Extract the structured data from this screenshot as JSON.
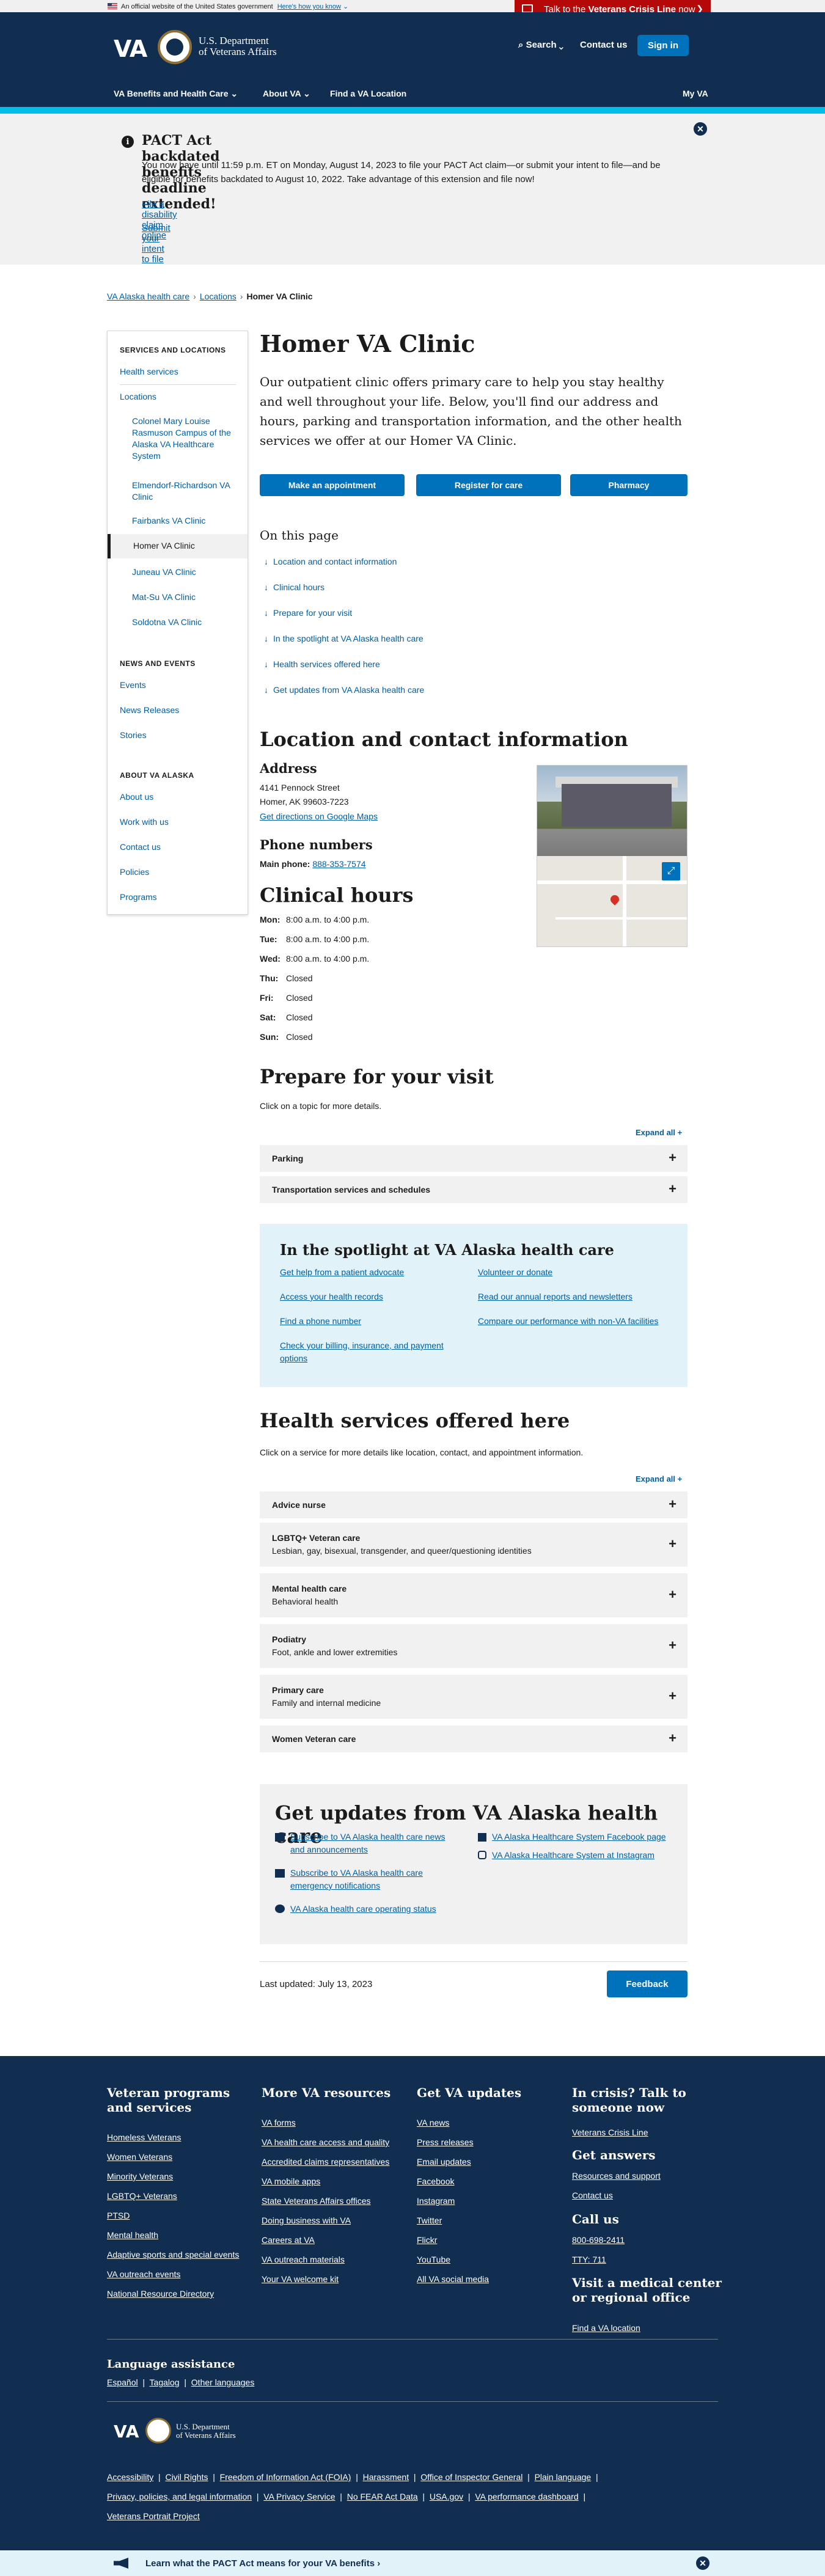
{
  "gov_banner": {
    "text": "An official website of the United States government",
    "how_link": "Here's how you know"
  },
  "crisis": {
    "prefix": "Talk to the ",
    "bold": "Veterans Crisis Line",
    "suffix": " now"
  },
  "header": {
    "logo": "VA",
    "dept_line1": "U.S. Department",
    "dept_line2": "of Veterans Affairs",
    "search": "Search",
    "contact": "Contact us",
    "signin": "Sign in",
    "nav": [
      "VA Benefits and Health Care",
      "About VA",
      "Find a VA Location",
      "My VA"
    ]
  },
  "alert": {
    "title": "PACT Act backdated benefits deadline extended!",
    "body": "You now have until 11:59 p.m. ET on Monday, August 14, 2023 to file your PACT Act claim—or submit your intent to file—and be eligible for benefits backdated to August 10, 2022. Take advantage of this extension and file now!",
    "link1": "File a disability claim online",
    "link2": "Submit your intent to file"
  },
  "breadcrumb": [
    "VA Alaska health care",
    "Locations",
    "Homer VA Clinic"
  ],
  "sidebar": {
    "h1": "SERVICES AND LOCATIONS",
    "health_services": "Health services",
    "locations": "Locations",
    "loc_items": [
      "Colonel Mary Louise Rasmuson Campus of the Alaska VA Healthcare System",
      "Elmendorf-Richardson VA Clinic",
      "Fairbanks VA Clinic",
      "Homer VA Clinic",
      "Juneau VA Clinic",
      "Mat-Su VA Clinic",
      "Soldotna VA Clinic"
    ],
    "h2": "NEWS AND EVENTS",
    "news": [
      "Events",
      "News Releases",
      "Stories"
    ],
    "h3": "ABOUT VA ALASKA",
    "about": [
      "About us",
      "Work with us",
      "Contact us",
      "Policies",
      "Programs"
    ]
  },
  "main": {
    "title": "Homer VA Clinic",
    "intro": "Our outpatient clinic offers primary care to help you stay healthy and well throughout your life. Below, you'll find our address and hours, parking and transportation information, and the other health services we offer at our Homer VA Clinic.",
    "buttons": [
      "Make an appointment",
      "Register for care",
      "Pharmacy"
    ],
    "on_this_page": "On this page",
    "jump_links": [
      "Location and contact information",
      "Clinical hours",
      "Prepare for your visit",
      "In the spotlight at VA Alaska health care",
      "Health services offered here",
      "Get updates from VA Alaska health care"
    ],
    "location_heading": "Location and contact information",
    "address_heading": "Address",
    "address_line1": "4141 Pennock Street",
    "address_line2": "Homer, AK 99603-7223",
    "directions": "Get directions on Google Maps",
    "phone_heading": "Phone numbers",
    "main_phone_label": "Main phone:",
    "main_phone": "888-353-7574",
    "hours_heading": "Clinical hours",
    "hours": [
      {
        "day": "Mon:",
        "time": "8:00 a.m. to 4:00 p.m."
      },
      {
        "day": "Tue:",
        "time": "8:00 a.m. to 4:00 p.m."
      },
      {
        "day": "Wed:",
        "time": "8:00 a.m. to 4:00 p.m."
      },
      {
        "day": "Thu:",
        "time": "Closed"
      },
      {
        "day": "Fri:",
        "time": "Closed"
      },
      {
        "day": "Sat:",
        "time": "Closed"
      },
      {
        "day": "Sun:",
        "time": "Closed"
      }
    ],
    "prepare_heading": "Prepare for your visit",
    "prepare_sub": "Click on a topic for more details.",
    "expand_all": "Expand all +",
    "prepare_items": [
      "Parking",
      "Transportation services and schedules"
    ],
    "spotlight_heading": "In the spotlight at VA Alaska health care",
    "spotlight_left": [
      "Get help from a patient advocate",
      "Access your health records",
      "Find a phone number",
      "Check your billing, insurance, and payment options"
    ],
    "spotlight_right": [
      "Volunteer or donate",
      "Read our annual reports and newsletters",
      "Compare our performance with non-VA facilities"
    ],
    "services_heading": "Health services offered here",
    "services_sub": "Click on a service for more details like location, contact, and appointment information.",
    "services": [
      {
        "title": "Advice nurse",
        "sub": ""
      },
      {
        "title": "LGBTQ+ Veteran care",
        "sub": "Lesbian, gay, bisexual, transgender, and queer/questioning identities"
      },
      {
        "title": "Mental health care",
        "sub": "Behavioral health"
      },
      {
        "title": "Podiatry",
        "sub": "Foot, ankle and lower extremities"
      },
      {
        "title": "Primary care",
        "sub": "Family and internal medicine"
      },
      {
        "title": "Women Veteran care",
        "sub": ""
      }
    ],
    "updates_heading": "Get updates from VA Alaska health care",
    "updates_left": [
      "Subscribe to VA Alaska health care news and announcements",
      "Subscribe to VA Alaska health care emergency notifications",
      "VA Alaska health care operating status"
    ],
    "updates_right": [
      "VA Alaska Healthcare System Facebook page",
      "VA Alaska Healthcare System at Instagram"
    ],
    "last_updated": "Last updated: July 13, 2023",
    "feedback": "Feedback"
  },
  "footer": {
    "col1_heading": "Veteran programs and services",
    "col1": [
      "Homeless Veterans",
      "Women Veterans",
      "Minority Veterans",
      "LGBTQ+ Veterans",
      "PTSD",
      "Mental health",
      "Adaptive sports and special events",
      "VA outreach events",
      "National Resource Directory"
    ],
    "col2_heading": "More VA resources",
    "col2": [
      "VA forms",
      "VA health care access and quality",
      "Accredited claims representatives",
      "VA mobile apps",
      "State Veterans Affairs offices",
      "Doing business with VA",
      "Careers at VA",
      "VA outreach materials",
      "Your VA welcome kit"
    ],
    "col3_heading": "Get VA updates",
    "col3": [
      "VA news",
      "Press releases",
      "Email updates",
      "Facebook",
      "Instagram",
      "Twitter",
      "Flickr",
      "YouTube",
      "All VA social media"
    ],
    "col4_heading": "In crisis? Talk to someone now",
    "col4_link": "Veterans Crisis Line",
    "answers_heading": "Get answers",
    "answers": [
      "Resources and support",
      "Contact us"
    ],
    "call_heading": "Call us",
    "call": [
      "800-698-2411",
      "TTY: 711"
    ],
    "visit_heading": "Visit a medical center or regional office",
    "visit_link": "Find a VA location",
    "lang_heading": "Language assistance",
    "langs": [
      "Español",
      "Tagalog",
      "Other languages"
    ],
    "bottom_links_row1": [
      "Accessibility",
      "Civil Rights",
      "Freedom of Information Act (FOIA)",
      "Harassment",
      "Office of Inspector General",
      "Plain language"
    ],
    "bottom_links_row2": [
      "Privacy, policies, and legal information",
      "VA Privacy Service",
      "No FEAR Act Data",
      "USA.gov",
      "VA performance dashboard"
    ],
    "bottom_links_row3": [
      "Veterans Portrait Project"
    ]
  },
  "bottom_bar": {
    "text": "Learn what the PACT Act means for your VA benefits ›"
  },
  "icons": [
    "flag-icon",
    "phone-icon",
    "search-icon",
    "info-icon",
    "close-icon",
    "arrow-down-icon",
    "plus-icon",
    "expand-map-icon",
    "mail-icon",
    "facebook-icon",
    "instagram-icon",
    "status-icon",
    "megaphone-icon"
  ]
}
